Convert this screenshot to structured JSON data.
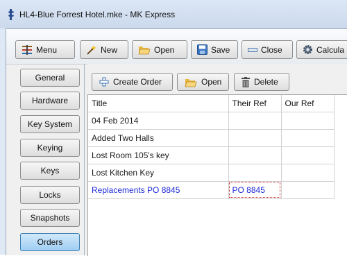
{
  "window": {
    "title": "HL4-Blue Forrest Hotel.mke - MK Express"
  },
  "toolbar": {
    "buttons": [
      {
        "label": "Menu",
        "icon": "menu-icon"
      },
      {
        "label": "New",
        "icon": "new-wand-icon"
      },
      {
        "label": "Open",
        "icon": "folder-open-icon"
      },
      {
        "label": "Save",
        "icon": "floppy-save-icon"
      },
      {
        "label": "Close",
        "icon": "close-bar-icon"
      },
      {
        "label": "Calcula",
        "icon": "gear-calculate-icon"
      }
    ]
  },
  "sidebar": {
    "items": [
      {
        "label": "General"
      },
      {
        "label": "Hardware"
      },
      {
        "label": "Key System"
      },
      {
        "label": "Keying"
      },
      {
        "label": "Keys"
      },
      {
        "label": "Locks"
      },
      {
        "label": "Snapshots"
      },
      {
        "label": "Orders",
        "active": true
      }
    ]
  },
  "orders": {
    "actions": [
      {
        "label": "Create Order",
        "icon": "add-icon"
      },
      {
        "label": "Open",
        "icon": "folder-open-icon"
      },
      {
        "label": "Delete",
        "icon": "trash-icon"
      }
    ],
    "columns": [
      "Title",
      "Their Ref",
      "Our Ref"
    ],
    "rows": [
      {
        "title": "04 Feb 2014",
        "their_ref": "",
        "our_ref": ""
      },
      {
        "title": "Added Two Halls",
        "their_ref": "",
        "our_ref": ""
      },
      {
        "title": "Lost Room 105's key",
        "their_ref": "",
        "our_ref": ""
      },
      {
        "title": "Lost Kitchen Key",
        "their_ref": "",
        "our_ref": ""
      },
      {
        "title": "Replacements PO 8845",
        "their_ref": "PO 8845",
        "our_ref": "",
        "selected": true
      }
    ]
  },
  "colors": {
    "selected_text": "#1f2ad8",
    "active_tab": "#9ecdf3",
    "focus_outline": "#cc2222"
  }
}
